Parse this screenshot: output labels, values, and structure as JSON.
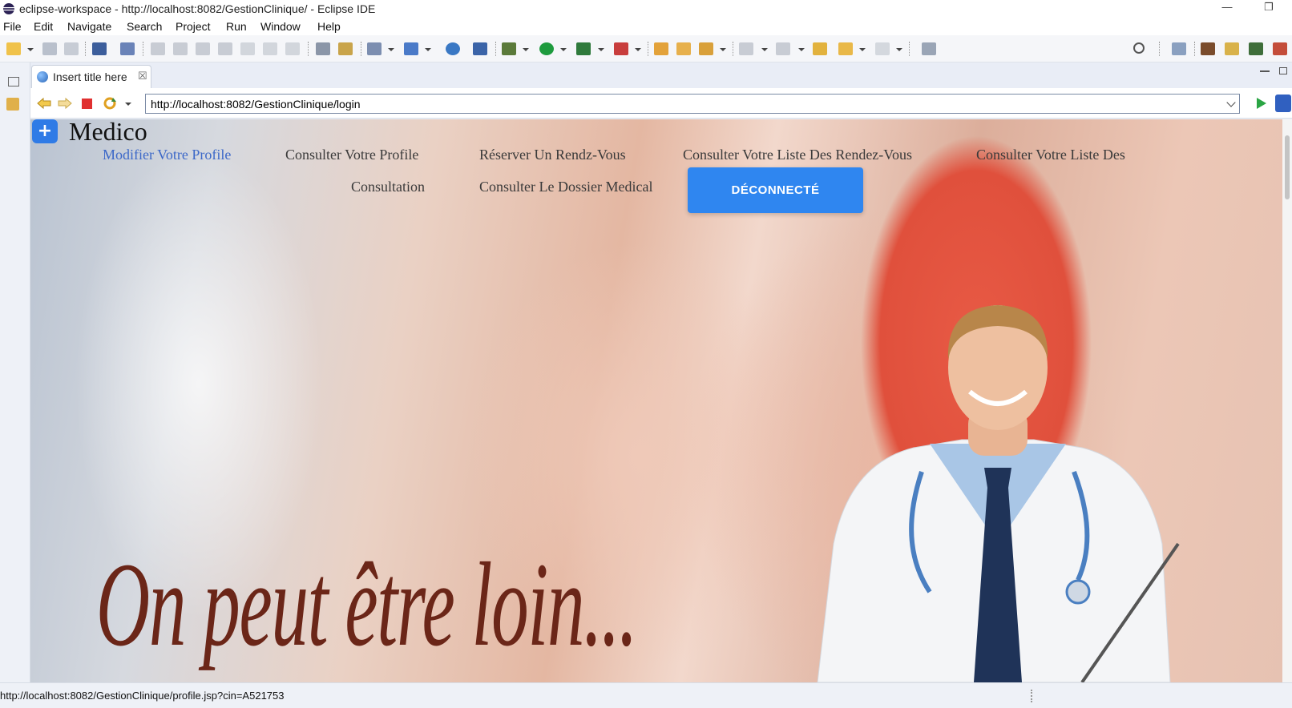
{
  "window": {
    "title": "eclipse-workspace - http://localhost:8082/GestionClinique/ - Eclipse IDE",
    "minimize": "—",
    "restore": "❐"
  },
  "menu": [
    "File",
    "Edit",
    "Navigate",
    "Search",
    "Project",
    "Run",
    "Window",
    "Help"
  ],
  "editor_tab": {
    "label": "Insert title here",
    "close": "☒"
  },
  "browser": {
    "url": "http://localhost:8082/GestionClinique/login"
  },
  "page": {
    "brand": "Medico",
    "brand_icon": "+",
    "nav": [
      "Modifier Votre Profile",
      "Consulter Votre Profile",
      "Réserver Un Rendz-Vous",
      "Consulter Votre Liste Des Rendez-Vous",
      "Consulter Votre Liste Des",
      "Consultation",
      "Consulter Le Dossier Medical"
    ],
    "logout": "DÉCONNECTÉ",
    "slogan": "On peut être loin..."
  },
  "status": {
    "text": "http://localhost:8082/GestionClinique/profile.jsp?cin=A521753"
  },
  "colors": {
    "accent": "#2f86f0",
    "active_link": "#3c68c8",
    "slogan": "#6b2618"
  }
}
